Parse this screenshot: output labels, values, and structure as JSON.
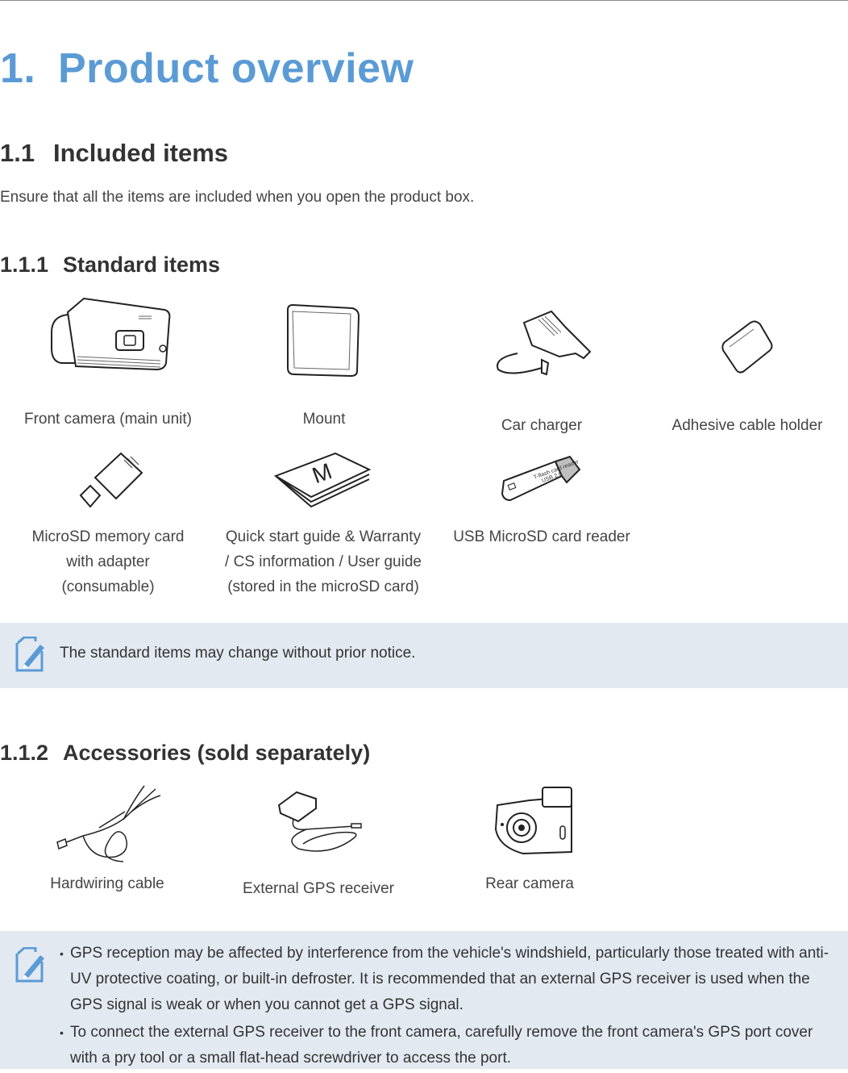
{
  "heading": {
    "number": "1.",
    "title": "Product overview"
  },
  "section": {
    "number": "1.1",
    "title": "Included items",
    "intro": "Ensure that all the items are included when you open the product box."
  },
  "standard": {
    "number": "1.1.1",
    "title": "Standard items",
    "items": [
      {
        "icon": "front-camera-icon",
        "label": "Front camera (main unit)"
      },
      {
        "icon": "mount-icon",
        "label": "Mount"
      },
      {
        "icon": "car-charger-icon",
        "label": "Car charger"
      },
      {
        "icon": "adhesive-cable-holder-icon",
        "label": "Adhesive cable holder"
      },
      {
        "icon": "microsd-card-icon",
        "label_lines": [
          "MicroSD memory card",
          "with adapter",
          "(consumable)"
        ]
      },
      {
        "icon": "quick-start-guide-icon",
        "label_lines": [
          "Quick start guide & Warranty",
          "/ CS information / User guide",
          "(stored in the microSD card)"
        ],
        "glyph": "M"
      },
      {
        "icon": "usb-card-reader-icon",
        "label": "USB MicroSD card reader",
        "print_lines": [
          "T-flash card reader",
          "USB 2.0"
        ]
      }
    ],
    "note": "The standard items may change without prior notice."
  },
  "accessories": {
    "number": "1.1.2",
    "title": "Accessories (sold separately)",
    "items": [
      {
        "icon": "hardwiring-cable-icon",
        "label": "Hardwiring cable"
      },
      {
        "icon": "gps-receiver-icon",
        "label": "External GPS receiver"
      },
      {
        "icon": "rear-camera-icon",
        "label": "Rear camera"
      }
    ],
    "notes": [
      "GPS reception may be affected by interference from the vehicle's windshield, particularly those treated with anti-UV protective coating, or built-in defroster. It is recommended that an external GPS receiver is used when the GPS signal is weak or when you cannot get a GPS signal.",
      "To connect the external GPS receiver to the front camera, carefully remove the front camera's GPS port cover with a pry tool or a small flat-head screwdriver to access the port."
    ]
  },
  "colors": {
    "accent": "#5b9bd5",
    "note_bg": "#e2e9f1",
    "text": "#333333"
  }
}
